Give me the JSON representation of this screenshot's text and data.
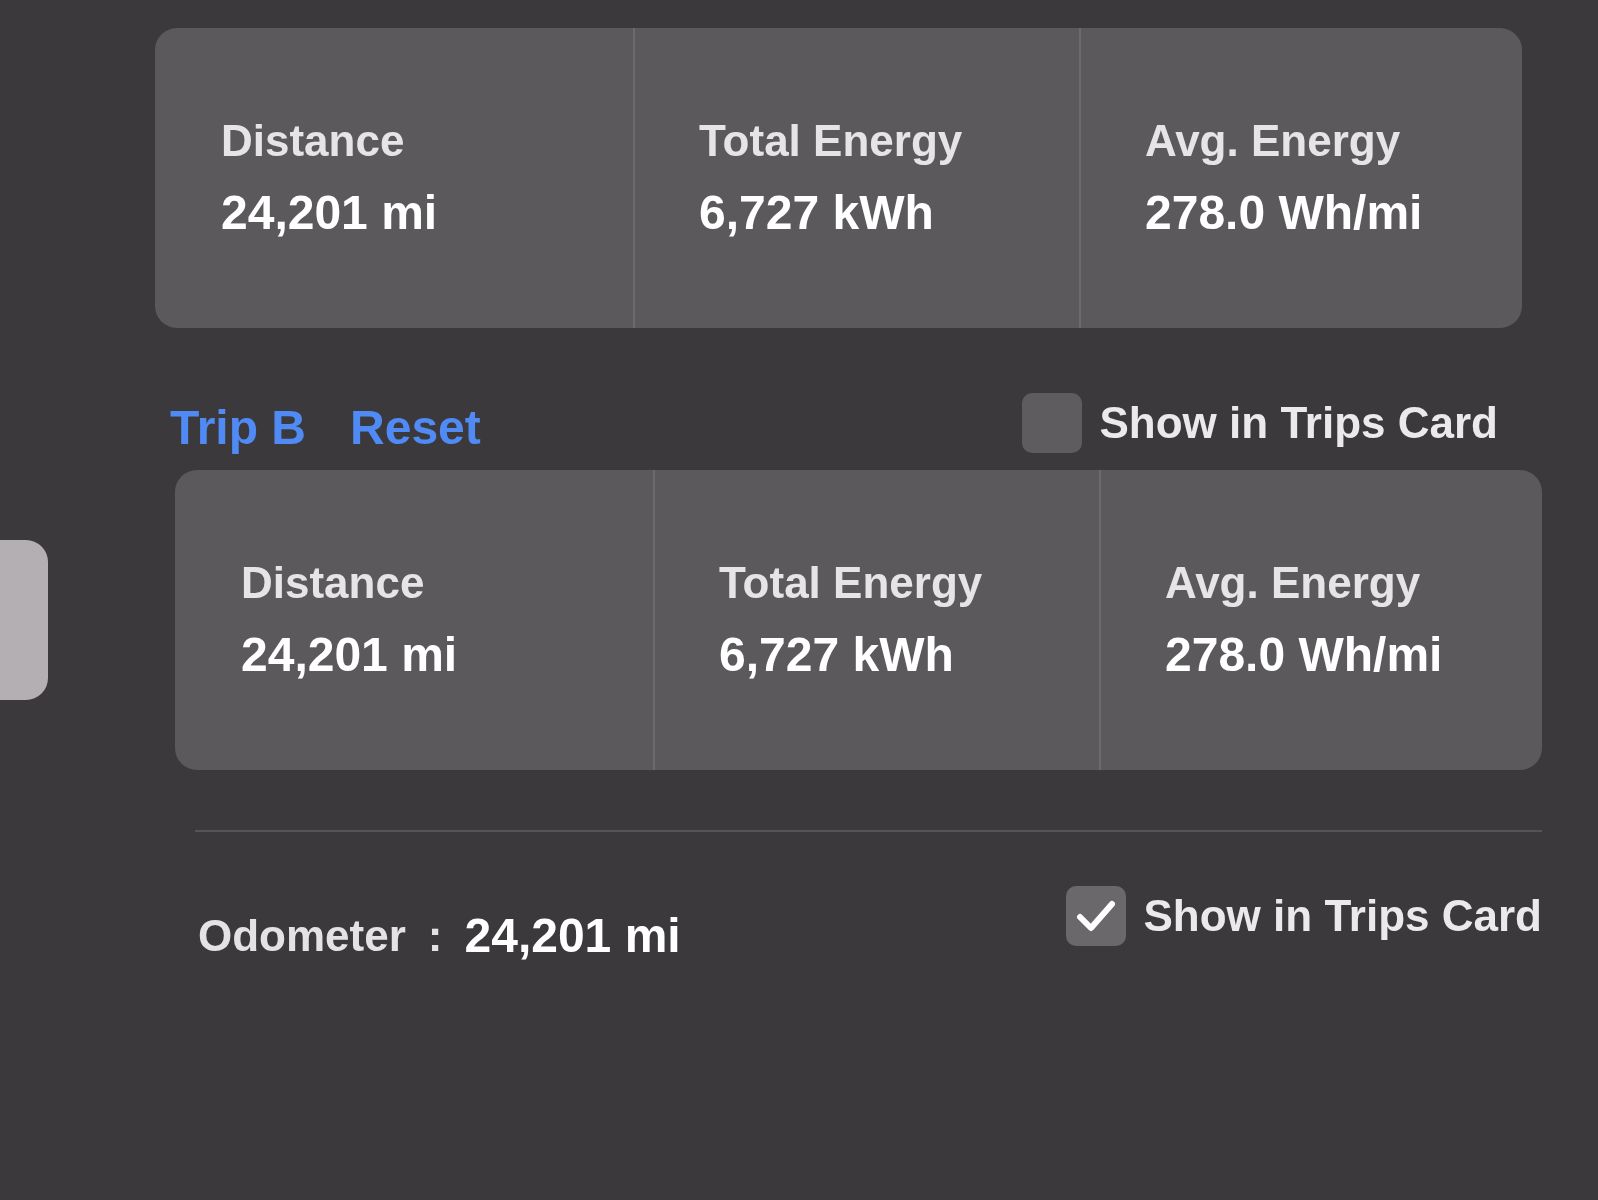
{
  "trip_a_card": {
    "stats": [
      {
        "label": "Distance",
        "value": "24,201 mi"
      },
      {
        "label": "Total Energy",
        "value": "6,727 kWh"
      },
      {
        "label": "Avg. Energy",
        "value": "278.0 Wh/mi"
      }
    ]
  },
  "trip_b": {
    "title": "Trip B",
    "reset": "Reset",
    "show_in_trips_card": {
      "label": "Show in Trips Card",
      "checked": false
    },
    "stats": [
      {
        "label": "Distance",
        "value": "24,201 mi"
      },
      {
        "label": "Total Energy",
        "value": "6,727 kWh"
      },
      {
        "label": "Avg. Energy",
        "value": "278.0 Wh/mi"
      }
    ]
  },
  "odometer": {
    "label": "Odometer",
    "separator": ":",
    "value": "24,201 mi",
    "show_in_trips_card": {
      "label": "Show in Trips Card",
      "checked": true
    }
  }
}
